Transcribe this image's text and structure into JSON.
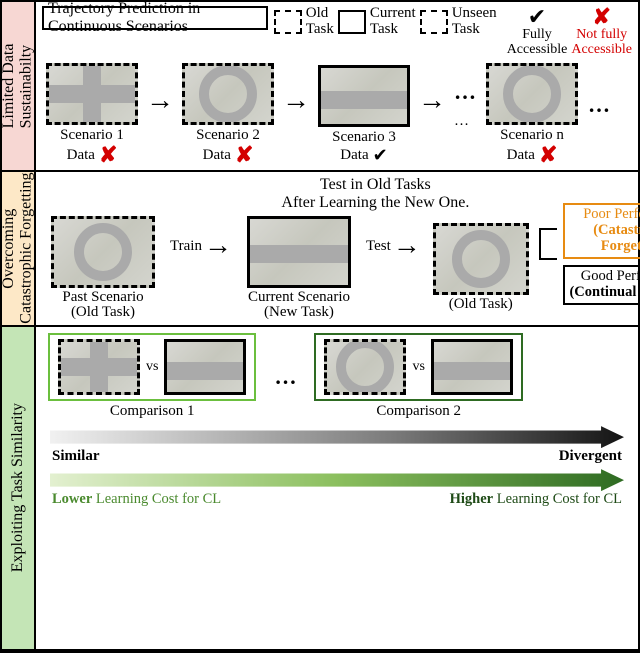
{
  "section_labels": {
    "s1": "Limited\nData Sustainabilty",
    "s2": "Overcoming\nCatastrophic Forgetting",
    "s3": "Exploiting\nTask Similarity"
  },
  "legend": {
    "title": "Trajectory Prediction in Continuous Scenarios",
    "old": "Old\nTask",
    "current": "Current\nTask",
    "unseen": "Unseen\nTask",
    "fully": "Fully\nAccessible",
    "notfully": "Not fully\nAccessible"
  },
  "scenarios": {
    "s1": "Scenario 1",
    "s2": "Scenario 2",
    "s3": "Scenario 3",
    "sn": "Scenario n",
    "data": "Data",
    "dots": "…"
  },
  "marks": {
    "check": "✔",
    "x": "✘"
  },
  "s2": {
    "title1": "Test in Old Tasks",
    "title2": "After Learning the New One.",
    "past": "Past Scenario\n(Old Task)",
    "cur": "Current Scenario\n(New Task)",
    "old2": "(Old Task)",
    "train": "Train",
    "test": "Test",
    "poor1": "Poor Performance",
    "poor2": "(Catastrophic Forgetting)",
    "good1": "Good Performance",
    "good2": "(Continual Learning)"
  },
  "s3": {
    "vs": "vs",
    "cmp1": "Comparison 1",
    "cmp2": "Comparison 2",
    "similar": "Similar",
    "divergent": "Divergent",
    "low": "Lower",
    "high": "Higher",
    "rest_low": " Learning Cost for CL",
    "rest_high": " Learning Cost for CL"
  }
}
